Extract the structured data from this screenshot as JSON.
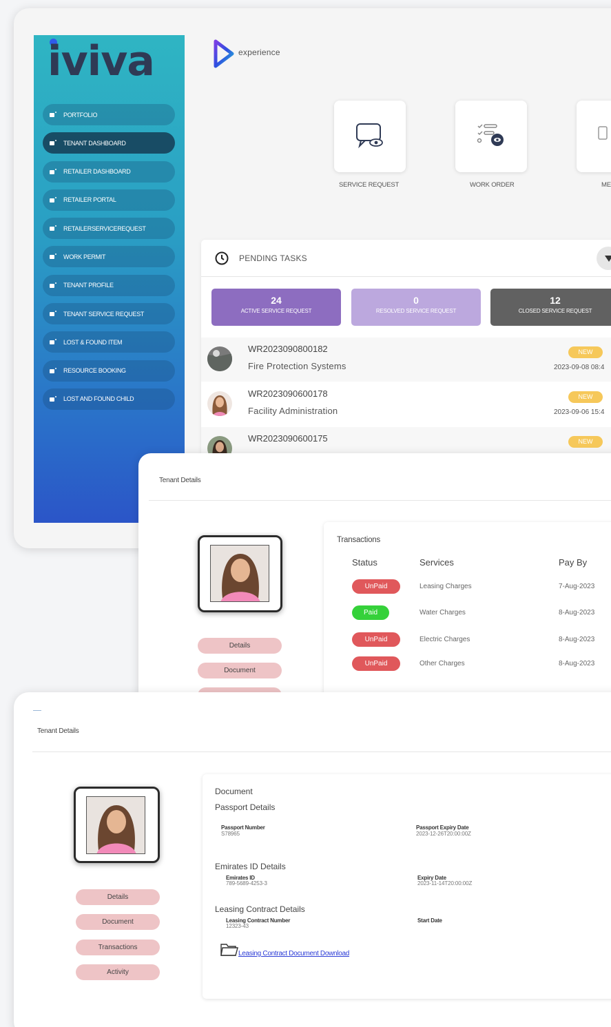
{
  "sidebar": {
    "logo": "iviva",
    "items": [
      {
        "label": "PORTFOLIO"
      },
      {
        "label": "TENANT DASHBOARD"
      },
      {
        "label": "RETAILER DASHBOARD"
      },
      {
        "label": "RETAILER PORTAL"
      },
      {
        "label": "RETAILERSERVICEREQUEST"
      },
      {
        "label": "WORK PERMIT"
      },
      {
        "label": "TENANT PROFILE"
      },
      {
        "label": "TENANT SERVICE REQUEST"
      },
      {
        "label": "LOST & FOUND ITEM"
      },
      {
        "label": "RESOURCE BOOKING"
      },
      {
        "label": "LOST AND FOUND CHILD"
      }
    ]
  },
  "header": {
    "brand": "experience"
  },
  "tiles": [
    {
      "label": "SERVICE REQUEST"
    },
    {
      "label": "WORK ORDER"
    },
    {
      "label": "ME"
    }
  ],
  "pending": {
    "title": "PENDING TASKS",
    "stats": [
      {
        "count": "24",
        "label": "ACTIVE SERVICE REQUEST",
        "color": "#8d6dc0"
      },
      {
        "count": "0",
        "label": "RESOLVED SERVICE REQUEST",
        "color": "#bca8de"
      },
      {
        "count": "12",
        "label": "CLOSED SERVICE REQUEST",
        "color": "#616161"
      }
    ],
    "tasks": [
      {
        "id": "WR2023090800182",
        "name": "Fire Protection Systems",
        "badge": "NEW",
        "date": "2023-09-08 08:4"
      },
      {
        "id": "WR2023090600178",
        "name": "Facility Administration",
        "badge": "NEW",
        "date": "2023-09-06 15:4"
      },
      {
        "id": "WR2023090600175",
        "name": "",
        "badge": "NEW",
        "date": ""
      }
    ]
  },
  "tenant_tx": {
    "title": "Tenant Details",
    "buttons": [
      "Details",
      "Document"
    ],
    "panel_title": "Transactions",
    "columns": [
      "Status",
      "Services",
      "Pay By"
    ],
    "rows": [
      {
        "status": "UnPaid",
        "service": "Leasing Charges",
        "pay_by": "7-Aug-2023"
      },
      {
        "status": "Paid",
        "service": "Water Charges",
        "pay_by": "8-Aug-2023"
      },
      {
        "status": "UnPaid",
        "service": "Electric Charges",
        "pay_by": "8-Aug-2023"
      },
      {
        "status": "UnPaid",
        "service": "Other Charges",
        "pay_by": "8-Aug-2023"
      }
    ],
    "colors": {
      "unpaid": "#e0585b",
      "paid": "#35d13a"
    }
  },
  "tenant_doc": {
    "title": "Tenant Details",
    "buttons": [
      "Details",
      "Document",
      "Transactions",
      "Activity"
    ],
    "panel_title": "Document",
    "passport": {
      "heading": "Passport Details",
      "number_label": "Passport Number",
      "number_value": "S78965",
      "expiry_label": "Passport Expiry Date",
      "expiry_value": "2023-12-26T20:00:00Z"
    },
    "emirates": {
      "heading": "Emirates ID Details",
      "id_label": "Emirates ID",
      "id_value": "789-5689-4253-3",
      "expiry_label": "Expiry Date",
      "expiry_value": "2023-11-14T20:00:00Z"
    },
    "leasing": {
      "heading": "Leasing Contract Details",
      "number_label": "Leasing Contract Number",
      "number_value": "12323-43",
      "start_label": "Start Date",
      "download_link": "Leasing Contract Document Download"
    }
  }
}
